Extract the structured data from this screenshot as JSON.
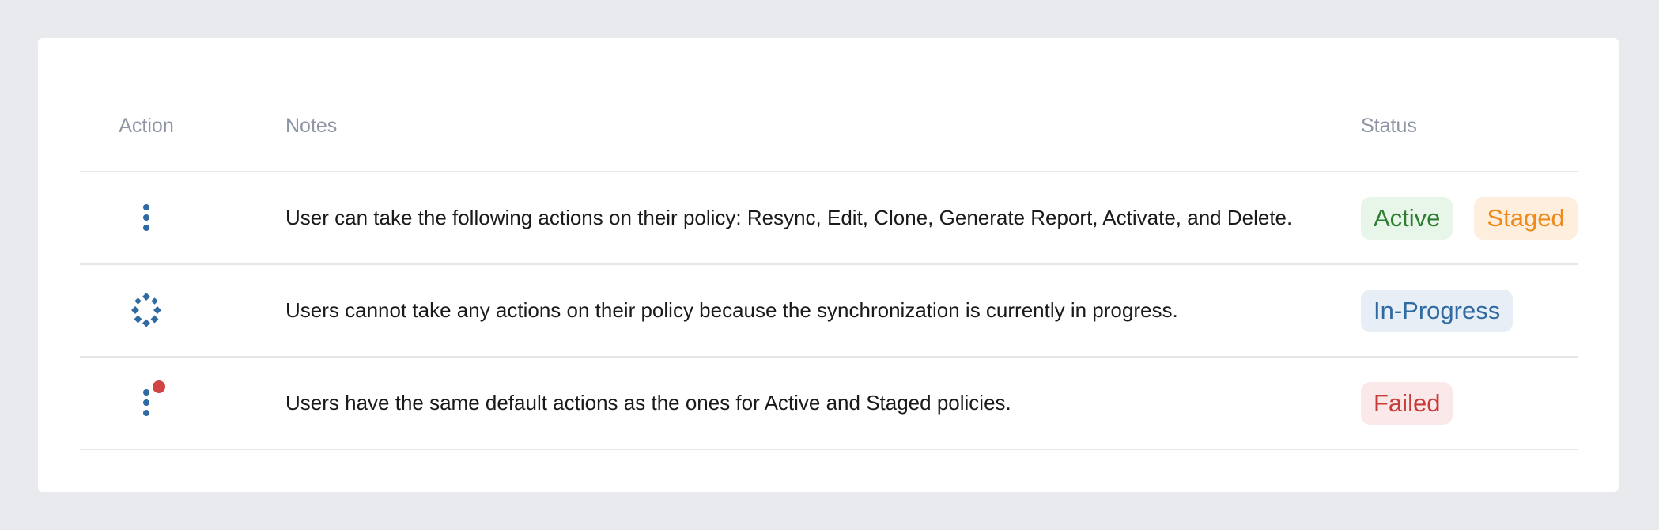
{
  "table": {
    "headers": {
      "action": "Action",
      "notes": "Notes",
      "status": "Status"
    },
    "rows": [
      {
        "action_icon": "kebab-menu-icon",
        "notes": "User can take the following actions on their policy: Resync, Edit, Clone, Generate Report, Activate, and Delete.",
        "badges": [
          {
            "label": "Active",
            "color": "#2e7d32",
            "bg": "#e8f5e9"
          },
          {
            "label": "Staged",
            "color": "#ef8a1a",
            "bg": "#fdeedd"
          }
        ]
      },
      {
        "action_icon": "loading-spinner-icon",
        "notes": "Users cannot take any actions on their policy because the synchronization is currently in progress.",
        "badges": [
          {
            "label": "In-Progress",
            "color": "#2f6aa3",
            "bg": "#e8eef6"
          }
        ]
      },
      {
        "action_icon": "kebab-menu-alert-icon",
        "notes": "Users have the same default actions as the ones for Active and Staged policies.",
        "badges": [
          {
            "label": "Failed",
            "color": "#c83b3b",
            "bg": "#fbe9e9"
          }
        ]
      }
    ]
  },
  "colors": {
    "icon": "#2f6aa3",
    "alert_dot": "#d04444"
  }
}
